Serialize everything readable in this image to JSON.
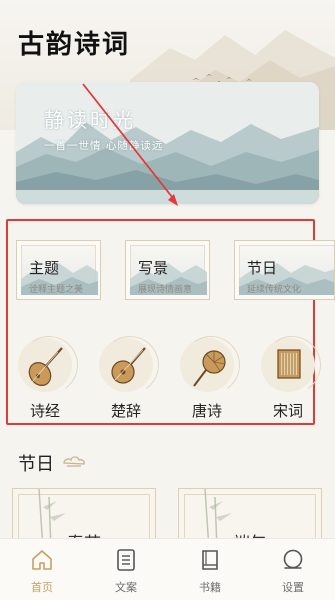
{
  "app": {
    "title": "古韵诗词"
  },
  "banner": {
    "title": "静读时光",
    "subtitle": "一首一世情 心随静读远"
  },
  "topics": [
    {
      "name": "主题",
      "desc": "诠释主题之美"
    },
    {
      "name": "写景",
      "desc": "展现诗情画意"
    },
    {
      "name": "节日",
      "desc": "延续传统文化"
    }
  ],
  "categories": [
    {
      "label": "诗经",
      "icon": "pipa-icon"
    },
    {
      "label": "楚辞",
      "icon": "ruan-icon"
    },
    {
      "label": "唐诗",
      "icon": "fan-icon"
    },
    {
      "label": "宋词",
      "icon": "book-icon"
    }
  ],
  "festival_section": {
    "title": "节日",
    "cards": [
      {
        "name": "春节"
      },
      {
        "name": "端午"
      }
    ]
  },
  "tabbar": {
    "items": [
      {
        "label": "首页",
        "icon": "home-icon",
        "active": true
      },
      {
        "label": "文案",
        "icon": "document-icon",
        "active": false
      },
      {
        "label": "书籍",
        "icon": "book-icon",
        "active": false
      },
      {
        "label": "设置",
        "icon": "settings-icon",
        "active": false
      }
    ]
  },
  "colors": {
    "accent": "#c8a063",
    "highlight_box": "#e23a3a"
  }
}
